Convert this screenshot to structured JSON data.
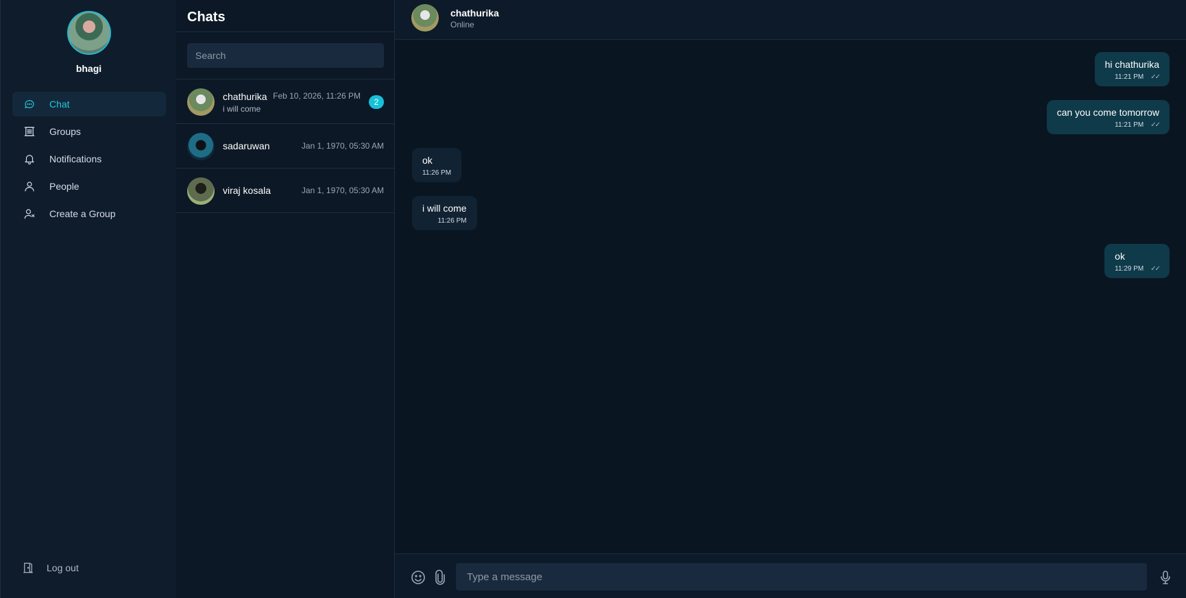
{
  "profile": {
    "name": "bhagi"
  },
  "nav": [
    {
      "label": "Chat",
      "icon": "chat-bubble-icon",
      "active": true
    },
    {
      "label": "Groups",
      "icon": "groups-icon",
      "active": false
    },
    {
      "label": "Notifications",
      "icon": "bell-icon",
      "active": false
    },
    {
      "label": "People",
      "icon": "person-icon",
      "active": false
    },
    {
      "label": "Create a Group",
      "icon": "add-group-icon",
      "active": false
    }
  ],
  "logout_label": "Log out",
  "chatlist": {
    "title": "Chats",
    "search_placeholder": "Search",
    "items": [
      {
        "name": "chathurika",
        "time": "Feb 10, 2026, 11:26 PM",
        "preview": "i will come",
        "unread": "2"
      },
      {
        "name": "sadaruwan",
        "time": "Jan 1, 1970, 05:30 AM",
        "preview": "",
        "unread": ""
      },
      {
        "name": "viraj kosala",
        "time": "Jan 1, 1970, 05:30 AM",
        "preview": "",
        "unread": ""
      }
    ]
  },
  "conversation": {
    "name": "chathurika",
    "status": "Online",
    "messages": [
      {
        "direction": "out",
        "text": "hi chathurika",
        "time": "11:21 PM",
        "ticks": "✓✓"
      },
      {
        "direction": "out",
        "text": "can you come tomorrow",
        "time": "11:21 PM",
        "ticks": "✓✓"
      },
      {
        "direction": "in",
        "text": "ok",
        "time": "11:26 PM"
      },
      {
        "direction": "in",
        "text": "i will come",
        "time": "11:26 PM"
      },
      {
        "direction": "out",
        "text": "ok",
        "time": "11:29 PM",
        "ticks": "✓✓"
      }
    ],
    "input_placeholder": "Type a message"
  },
  "colors": {
    "accent": "#26c6da",
    "badge": "#17c1d9",
    "outgoing_bubble": "#0f3a4a",
    "incoming_bubble": "#112233",
    "background": "#0a1522"
  }
}
